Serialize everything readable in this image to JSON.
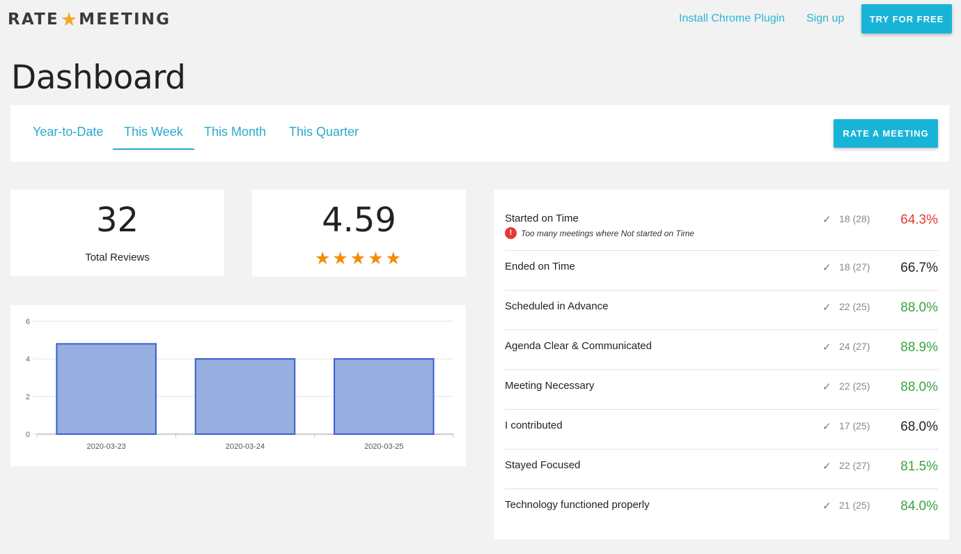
{
  "header": {
    "logo_left": "RATE",
    "logo_right": "MEETING",
    "install_plugin": "Install Chrome Plugin",
    "sign_up": "Sign up",
    "try_free": "TRY FOR FREE"
  },
  "page_title": "Dashboard",
  "tabs": [
    {
      "label": "Year-to-Date",
      "active": false
    },
    {
      "label": "This Week",
      "active": true
    },
    {
      "label": "This Month",
      "active": false
    },
    {
      "label": "This Quarter",
      "active": false
    }
  ],
  "rate_button": "RATE A MEETING",
  "stats": {
    "total_reviews_value": "32",
    "total_reviews_label": "Total Reviews",
    "average_rating": "4.59",
    "stars": "★★★★★"
  },
  "chart_data": {
    "type": "bar",
    "categories": [
      "2020-03-23",
      "2020-03-24",
      "2020-03-25"
    ],
    "values": [
      4.8,
      4.0,
      4.0
    ],
    "title": "",
    "xlabel": "",
    "ylabel": "",
    "ylim": [
      0,
      6
    ],
    "yticks": [
      "0",
      "2",
      "4",
      "6"
    ],
    "bar_color": "#96aee0",
    "bar_border": "#3a5fcd",
    "grid": true
  },
  "criteria": [
    {
      "name": "Started on Time",
      "count": "18 (28)",
      "percent": "64.3%",
      "status": "bad",
      "warning": "Too many meetings where Not started on Time"
    },
    {
      "name": "Ended on Time",
      "count": "18 (27)",
      "percent": "66.7%",
      "status": "neutral"
    },
    {
      "name": "Scheduled in Advance",
      "count": "22 (25)",
      "percent": "88.0%",
      "status": "good"
    },
    {
      "name": "Agenda Clear & Communicated",
      "count": "24 (27)",
      "percent": "88.9%",
      "status": "good"
    },
    {
      "name": "Meeting Necessary",
      "count": "22 (25)",
      "percent": "88.0%",
      "status": "good"
    },
    {
      "name": "I contributed",
      "count": "17 (25)",
      "percent": "68.0%",
      "status": "neutral"
    },
    {
      "name": "Stayed Focused",
      "count": "22 (27)",
      "percent": "81.5%",
      "status": "good"
    },
    {
      "name": "Technology functioned properly",
      "count": "21 (25)",
      "percent": "84.0%",
      "status": "good"
    }
  ],
  "colors": {
    "accent": "#18b4d7",
    "good": "#3aa33f",
    "bad": "#e53935",
    "neutral": "#222222"
  }
}
